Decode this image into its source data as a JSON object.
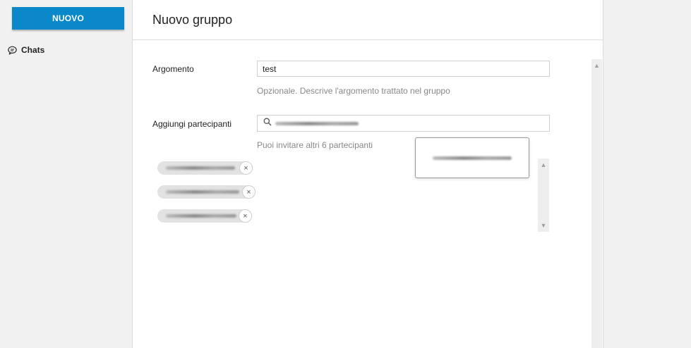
{
  "sidebar": {
    "new_button_label": "NUOVO",
    "nav": [
      {
        "label": "Chats",
        "icon": "chat-bubble-icon"
      }
    ]
  },
  "main": {
    "title": "Nuovo gruppo",
    "topic": {
      "label": "Argomento",
      "value": "test",
      "hint": "Opzionale. Descrive l'argomento trattato nel gruppo"
    },
    "participants": {
      "label": "Aggiungi partecipanti",
      "search_icon": "search-icon",
      "hint": "Puoi invitare altri 6 partecipanti",
      "chip_count": 3,
      "remove_icon": "close-icon",
      "remove_glyph": "×"
    },
    "suggestion_popup": {
      "item_count": 1
    }
  },
  "colors": {
    "primary": "#0a88c9",
    "chip_bg": "#e2e2e2",
    "hint_text": "#888888"
  }
}
